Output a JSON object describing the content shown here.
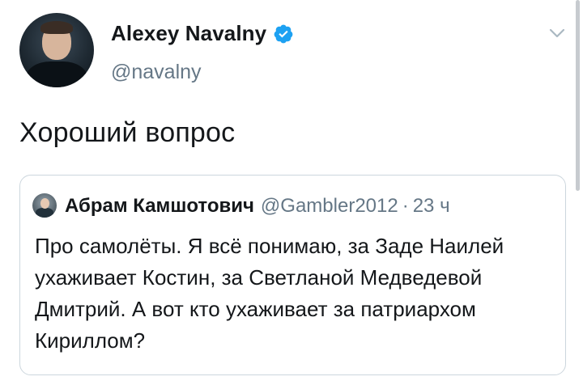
{
  "tweet": {
    "author": {
      "display_name": "Alexey Navalny",
      "handle": "@navalny",
      "verified": true
    },
    "text": "Хороший вопрос",
    "menu_icon": "chevron-down-icon"
  },
  "quoted_tweet": {
    "author": {
      "display_name": "Абрам Камшотович",
      "handle": "@Gambler2012"
    },
    "separator": "·",
    "time": "23 ч",
    "text": "Про самолёты. Я всё понимаю, за Заде Наилей ухаживает Костин, за Светланой Медведевой Дмитрий. А вот кто ухаживает за патриархом Кириллом?"
  },
  "colors": {
    "text_primary": "#14171a",
    "text_secondary": "#657786",
    "verified_blue": "#1da1f2",
    "border": "#ccd6dd"
  }
}
